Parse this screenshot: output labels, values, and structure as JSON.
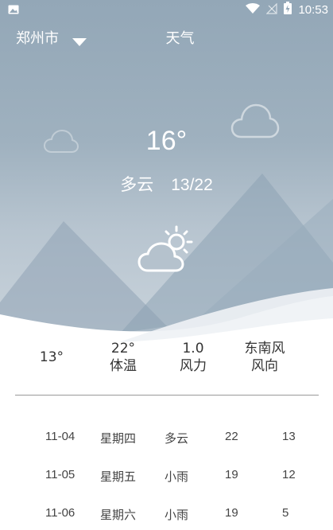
{
  "status_bar": {
    "time": "10:53",
    "icons": [
      "image-icon",
      "wifi-icon",
      "signal-off-icon",
      "battery-charging-icon"
    ]
  },
  "header": {
    "city": "郑州市",
    "title": "天气"
  },
  "current": {
    "temperature": "16°",
    "condition": "多云",
    "range": "13/22",
    "icon": "partly-cloudy-icon"
  },
  "details": [
    {
      "value": "13°",
      "label": ""
    },
    {
      "value": "22°",
      "label": "体温"
    },
    {
      "value": "1.0",
      "label": "风力"
    },
    {
      "value": "东南风",
      "label": "风向"
    }
  ],
  "forecast": [
    {
      "date": "11-04",
      "weekday": "星期四",
      "condition": "多云",
      "high": "22",
      "low": "13"
    },
    {
      "date": "11-05",
      "weekday": "星期五",
      "condition": "小雨",
      "high": "19",
      "low": "12"
    },
    {
      "date": "11-06",
      "weekday": "星期六",
      "condition": "小雨",
      "high": "19",
      "low": "5"
    }
  ],
  "colors": {
    "sky_top": "#93a7b7",
    "sky_bottom": "#cfd8df",
    "mountain": "#8ea2b3",
    "text_dark": "#333333"
  }
}
